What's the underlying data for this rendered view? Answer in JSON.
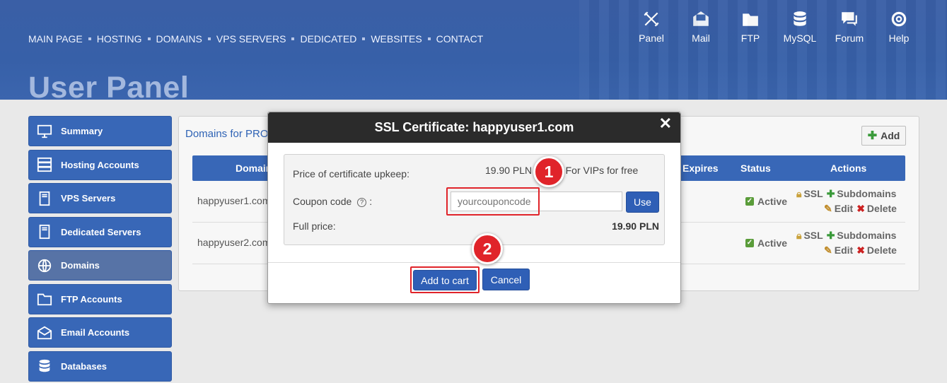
{
  "nav": [
    "MAIN PAGE",
    "HOSTING",
    "DOMAINS",
    "VPS SERVERS",
    "DEDICATED",
    "WEBSITES",
    "CONTACT"
  ],
  "top_icons": [
    {
      "label": "Panel",
      "icon": "tools-icon"
    },
    {
      "label": "Mail",
      "icon": "mail-icon"
    },
    {
      "label": "FTP",
      "icon": "folder-icon"
    },
    {
      "label": "MySQL",
      "icon": "database-icon"
    },
    {
      "label": "Forum",
      "icon": "chat-icon"
    },
    {
      "label": "Help",
      "icon": "lifebuoy-icon"
    }
  ],
  "page_title": "User Panel",
  "sidebar": [
    {
      "label": "Summary",
      "icon": "monitor-icon"
    },
    {
      "label": "Hosting Accounts",
      "icon": "server-icon"
    },
    {
      "label": "VPS Servers",
      "icon": "tower-icon"
    },
    {
      "label": "Dedicated Servers",
      "icon": "tower-icon"
    },
    {
      "label": "Domains",
      "icon": "www-icon"
    },
    {
      "label": "FTP Accounts",
      "icon": "folder-icon"
    },
    {
      "label": "Email Accounts",
      "icon": "envelope-icon"
    },
    {
      "label": "Databases",
      "icon": "database-icon"
    }
  ],
  "content": {
    "title": "Domains for PRO",
    "add_label": "Add",
    "columns": {
      "domain": "Domain",
      "expires": "Expires",
      "status": "Status",
      "actions": "Actions"
    },
    "rows": [
      {
        "domain": "happyuser1.com",
        "status": "Active"
      },
      {
        "domain": "happyuser2.com",
        "status": "Active"
      }
    ],
    "actions": {
      "ssl": "SSL",
      "subdomains": "Subdomains",
      "edit": "Edit",
      "delete": "Delete"
    }
  },
  "modal": {
    "title": "SSL Certificate: happyuser1.com",
    "close": "✕",
    "price_label": "Price of certificate upkeep:",
    "price_value": "19.90 PLN / year) For VIPs for free",
    "coupon_label": "Coupon code",
    "coupon_colon": ":",
    "coupon_placeholder": "yourcouponcode",
    "use_label": "Use",
    "full_label": "Full price:",
    "full_value": "19.90 PLN",
    "add_to_cart": "Add to cart",
    "cancel": "Cancel"
  },
  "badges": [
    "1",
    "2"
  ],
  "colors": {
    "header": "#3760a8",
    "accent": "#3867b7",
    "highlight": "#e0242a",
    "modal_head": "#2b2b2b"
  }
}
